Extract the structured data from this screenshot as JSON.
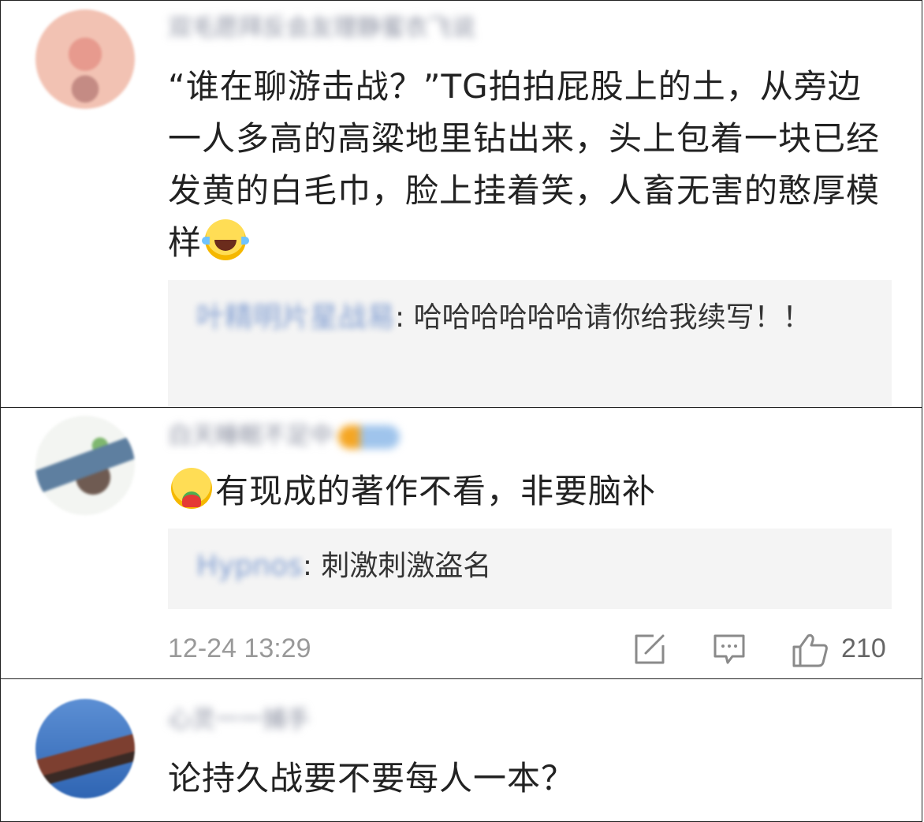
{
  "comments": [
    {
      "username": "双毛愿拜反会友理静蜜衣飞说",
      "content": "“谁在聊游击战？”TG拍拍屁股上的土，从旁边一人多高的高粱地里钻出来，头上包着一块已经发黄的白毛巾，脸上挂着笑，人畜无害的憨厚模样",
      "emoji": "laugh-cry-emoji",
      "reply": {
        "username": "叶精明片星战易",
        "text": "哈哈哈哈哈哈请你给我续写！！"
      }
    },
    {
      "username": "白天睡眠不足中",
      "emoji": "eating-emoji",
      "content": "有现成的著作不看，非要脑补",
      "reply": {
        "username": "Hypnos",
        "text": "刺激刺激盗名"
      },
      "timestamp": "12-24 13:29",
      "likes": "210"
    },
    {
      "username": "心灵一一捕手",
      "content": "论持久战要不要每人一本？"
    }
  ],
  "icons": {
    "share": "share-icon",
    "comment": "comment-icon",
    "like": "thumbs-up-icon"
  },
  "colors": {
    "reply_bg": "#f4f4f4",
    "reply_user": "#7d9bd0",
    "meta_text": "#999999"
  }
}
